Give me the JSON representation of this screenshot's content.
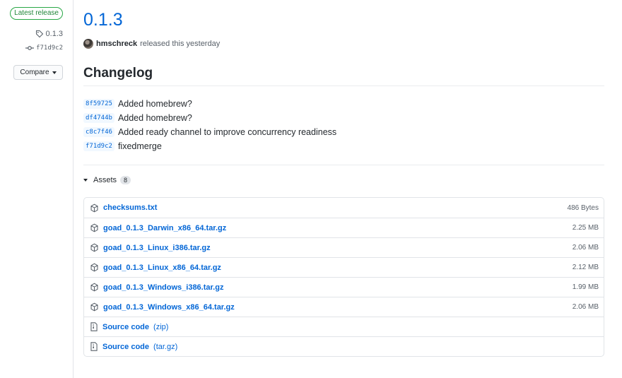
{
  "sidebar": {
    "badge": "Latest release",
    "tag": "0.1.3",
    "commit": "f71d9c2",
    "compare_label": "Compare"
  },
  "release": {
    "title": "0.1.3",
    "author": "hmschreck",
    "released_text": "released this yesterday"
  },
  "changelog": {
    "heading": "Changelog",
    "commits": [
      {
        "sha": "8f59725",
        "message": "Added homebrew?"
      },
      {
        "sha": "df4744b",
        "message": "Added homebrew?"
      },
      {
        "sha": "c8c7f46",
        "message": "Added ready channel to improve concurrency readiness"
      },
      {
        "sha": "f71d9c2",
        "message": "fixedmerge"
      }
    ]
  },
  "assets": {
    "label": "Assets",
    "count": "8",
    "files": [
      {
        "name": "checksums.txt",
        "size": "486 Bytes"
      },
      {
        "name": "goad_0.1.3_Darwin_x86_64.tar.gz",
        "size": "2.25 MB"
      },
      {
        "name": "goad_0.1.3_Linux_i386.tar.gz",
        "size": "2.06 MB"
      },
      {
        "name": "goad_0.1.3_Linux_x86_64.tar.gz",
        "size": "2.12 MB"
      },
      {
        "name": "goad_0.1.3_Windows_i386.tar.gz",
        "size": "1.99 MB"
      },
      {
        "name": "goad_0.1.3_Windows_x86_64.tar.gz",
        "size": "2.06 MB"
      }
    ],
    "source": [
      {
        "label": "Source code",
        "format": "(zip)"
      },
      {
        "label": "Source code",
        "format": "(tar.gz)"
      }
    ]
  }
}
